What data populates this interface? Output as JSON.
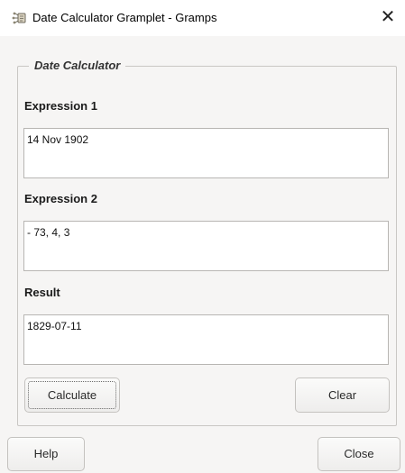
{
  "window": {
    "title": "Date Calculator Gramplet - Gramps",
    "close_glyph": "✕",
    "icon": "gramps-app-icon"
  },
  "frame": {
    "legend": "Date Calculator"
  },
  "expression1": {
    "label": "Expression 1",
    "value": "14 Nov 1902"
  },
  "expression2": {
    "label": "Expression 2",
    "value": "- 73, 4, 3"
  },
  "result": {
    "label": "Result",
    "value": "1829-07-11"
  },
  "buttons": {
    "calculate": "Calculate",
    "clear": "Clear",
    "help": "Help",
    "close": "Close"
  },
  "colors": {
    "window_bg": "#f6f5f4",
    "titlebar_bg": "#ffffff",
    "field_bg": "#ffffff",
    "border": "#c9c7c4"
  }
}
